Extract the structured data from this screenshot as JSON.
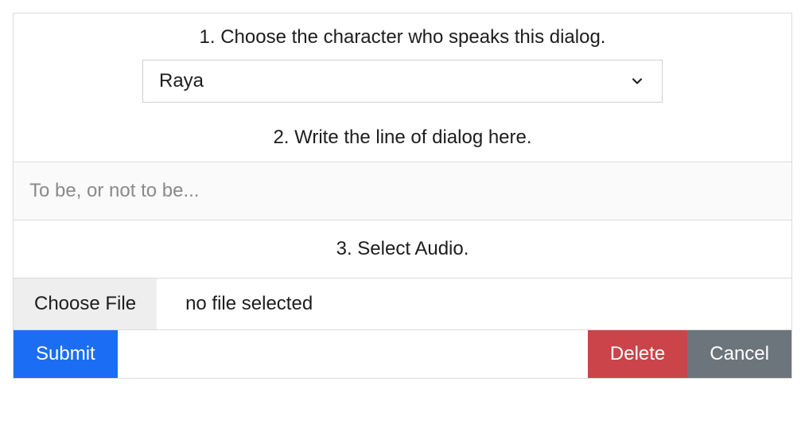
{
  "step1": {
    "label": "1. Choose the character who speaks this dialog.",
    "select": {
      "selected": "Raya"
    }
  },
  "step2": {
    "label": "2. Write the line of dialog here.",
    "input": {
      "placeholder": "To be, or not to be..."
    }
  },
  "step3": {
    "label": "3. Select Audio.",
    "file": {
      "button_label": "Choose File",
      "status": "no file selected"
    }
  },
  "actions": {
    "submit": "Submit",
    "delete": "Delete",
    "cancel": "Cancel"
  }
}
